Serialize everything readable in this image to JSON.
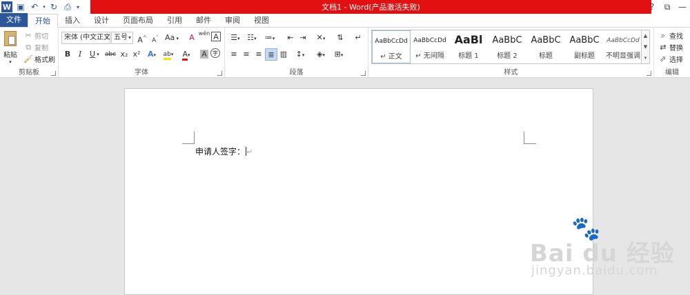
{
  "title": "文档1 - Word(产品激活失败)",
  "window_controls": [
    "?",
    "⧉",
    "—"
  ],
  "tabs": [
    "文件",
    "开始",
    "插入",
    "设计",
    "页面布局",
    "引用",
    "邮件",
    "审阅",
    "视图"
  ],
  "clipboard": {
    "paste": "粘贴",
    "cut": "剪切",
    "copy": "复制",
    "format_painter": "格式刷",
    "label": "剪贴板"
  },
  "font": {
    "name": "宋体 (中文正文)",
    "size": "五号",
    "grow": "A",
    "shrink": "A",
    "case": "Aa",
    "clear": "A",
    "phonetic": "wén",
    "border": "A",
    "bold": "B",
    "italic": "I",
    "underline": "U",
    "strike": "abc",
    "subscript": "x₂",
    "superscript": "x²",
    "effects": "A",
    "highlight": "ab",
    "color": "A",
    "shade": "A",
    "enclose": "字",
    "label": "字体"
  },
  "paragraph": {
    "label": "段落"
  },
  "styles": {
    "label": "样式",
    "items": [
      {
        "sample": "AaBbCcDd",
        "name": "↵ 正文"
      },
      {
        "sample": "AaBbCcDd",
        "name": "↵ 无间隔"
      },
      {
        "sample": "AaBl",
        "name": "标题 1"
      },
      {
        "sample": "AaBbC",
        "name": "标题 2"
      },
      {
        "sample": "AaBbC",
        "name": "标题"
      },
      {
        "sample": "AaBbC",
        "name": "副标题"
      },
      {
        "sample": "AaBbCcDd",
        "name": "不明显强调"
      }
    ]
  },
  "editing": {
    "find": "查找",
    "replace": "替换",
    "select": "选择",
    "label": "编辑"
  },
  "document": {
    "text": "申请人签字：",
    "mark": "↵"
  },
  "watermark": {
    "brand": "Bai du 经验",
    "url": "jingyan.baidu.com"
  }
}
